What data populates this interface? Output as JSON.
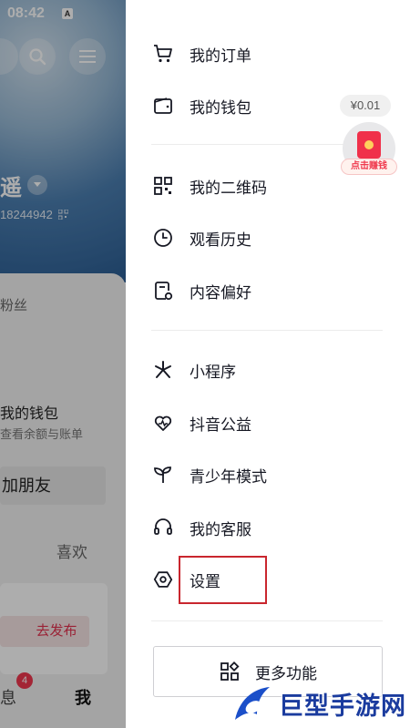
{
  "status_bar": {
    "time": "08:42",
    "notification_badge": "A"
  },
  "background_profile": {
    "username_fragment": "遥",
    "user_id_fragment": "18244942",
    "fans_label": "粉丝",
    "wallet_title": "我的钱包",
    "wallet_subtitle": "查看余额与账单",
    "add_friend": "加朋友",
    "likes_tab": "喜欢",
    "publish_button": "去发布",
    "tab_messages": "息",
    "messages_badge": "4",
    "tab_me": "我"
  },
  "drawer": {
    "menu_group_1": [
      {
        "label": "我的订单",
        "icon": "cart-icon"
      },
      {
        "label": "我的钱包",
        "icon": "wallet-icon",
        "badge": "¥0.01"
      }
    ],
    "menu_group_2": [
      {
        "label": "我的二维码",
        "icon": "qrcode-icon"
      },
      {
        "label": "观看历史",
        "icon": "clock-icon"
      },
      {
        "label": "内容偏好",
        "icon": "preference-icon"
      }
    ],
    "menu_group_3": [
      {
        "label": "小程序",
        "icon": "mini-program-icon"
      },
      {
        "label": "抖音公益",
        "icon": "charity-heart-icon"
      },
      {
        "label": "青少年模式",
        "icon": "sprout-icon"
      },
      {
        "label": "我的客服",
        "icon": "headset-icon"
      },
      {
        "label": "设置",
        "icon": "settings-icon"
      }
    ],
    "earn_button_label": "点击赚钱",
    "more_features": "更多功能",
    "highlight_color": "#c9262e"
  },
  "watermark": {
    "text": "巨型手游网"
  }
}
